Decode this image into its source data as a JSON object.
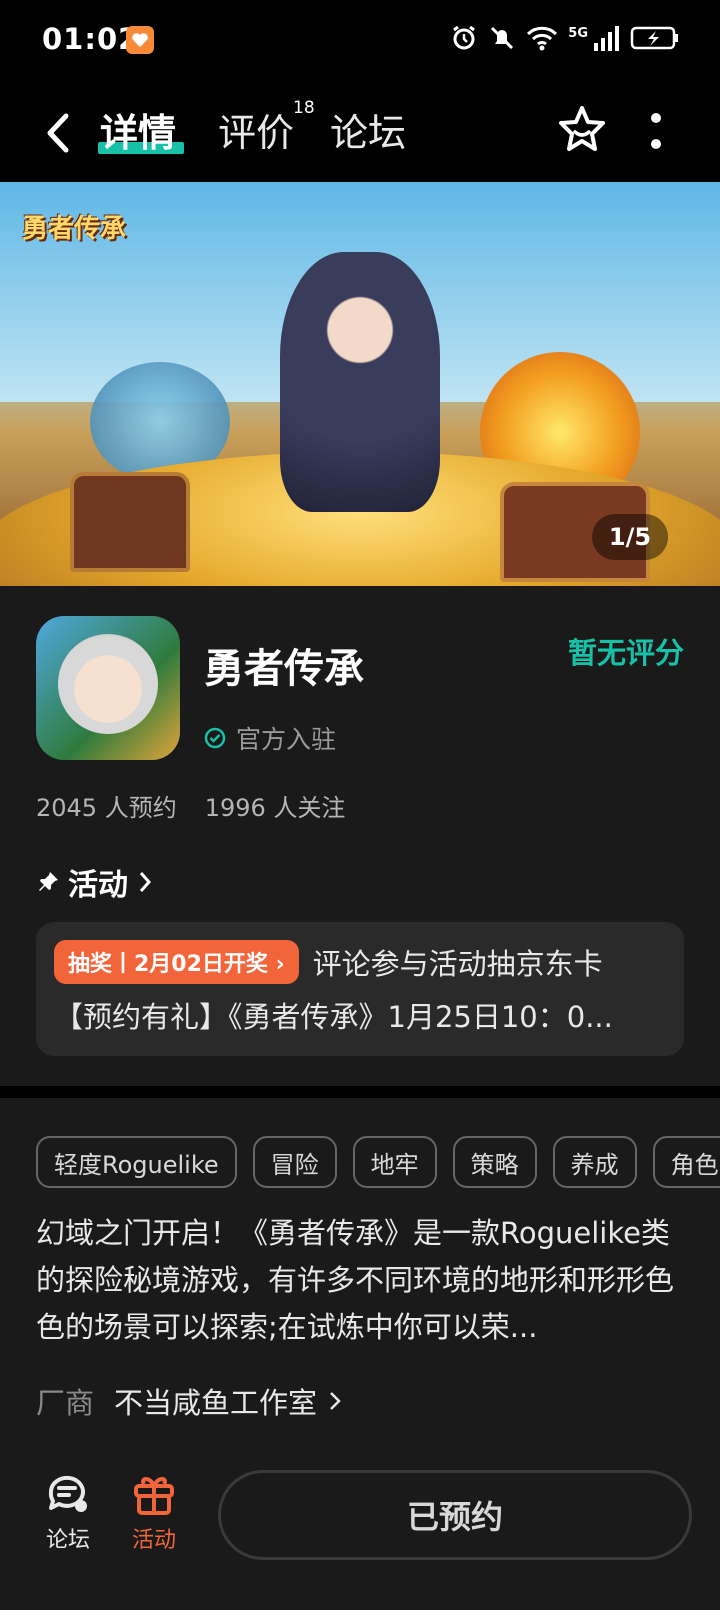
{
  "status_bar": {
    "time": "01:02",
    "network": "5G"
  },
  "header": {
    "tabs": [
      {
        "label": "详情",
        "active": true
      },
      {
        "label": "评价",
        "count": "18"
      },
      {
        "label": "论坛"
      }
    ]
  },
  "banner": {
    "logo_text": "勇者传承",
    "counter": "1/5"
  },
  "game": {
    "title": "勇者传承",
    "score_text": "暂无评分",
    "official_label": "官方入驻",
    "reservations": "2045 人预约",
    "followers": "1996 人关注"
  },
  "activity": {
    "heading": "活动",
    "tag": "抽奖丨2月02日开奖",
    "line1": "评论参与活动抽京东卡",
    "line2": "【预约有礼】《勇者传承》1月25日10：0..."
  },
  "tags": [
    "轻度Roguelike",
    "冒险",
    "地牢",
    "策略",
    "养成",
    "角色"
  ],
  "description": "幻域之门开启！《勇者传承》是一款Roguelike类的探险秘境游戏，有许多不同环境的地形和形形色色的场景可以探索;在试炼中你可以荣...",
  "vendor": {
    "label": "厂商",
    "name": "不当咸鱼工作室"
  },
  "bottom_bar": {
    "forum_label": "论坛",
    "activity_label": "活动",
    "reserve_button": "已预约"
  },
  "colors": {
    "accent": "#19c0a8",
    "orange": "#f2653a",
    "background": "#1a1a1a"
  }
}
